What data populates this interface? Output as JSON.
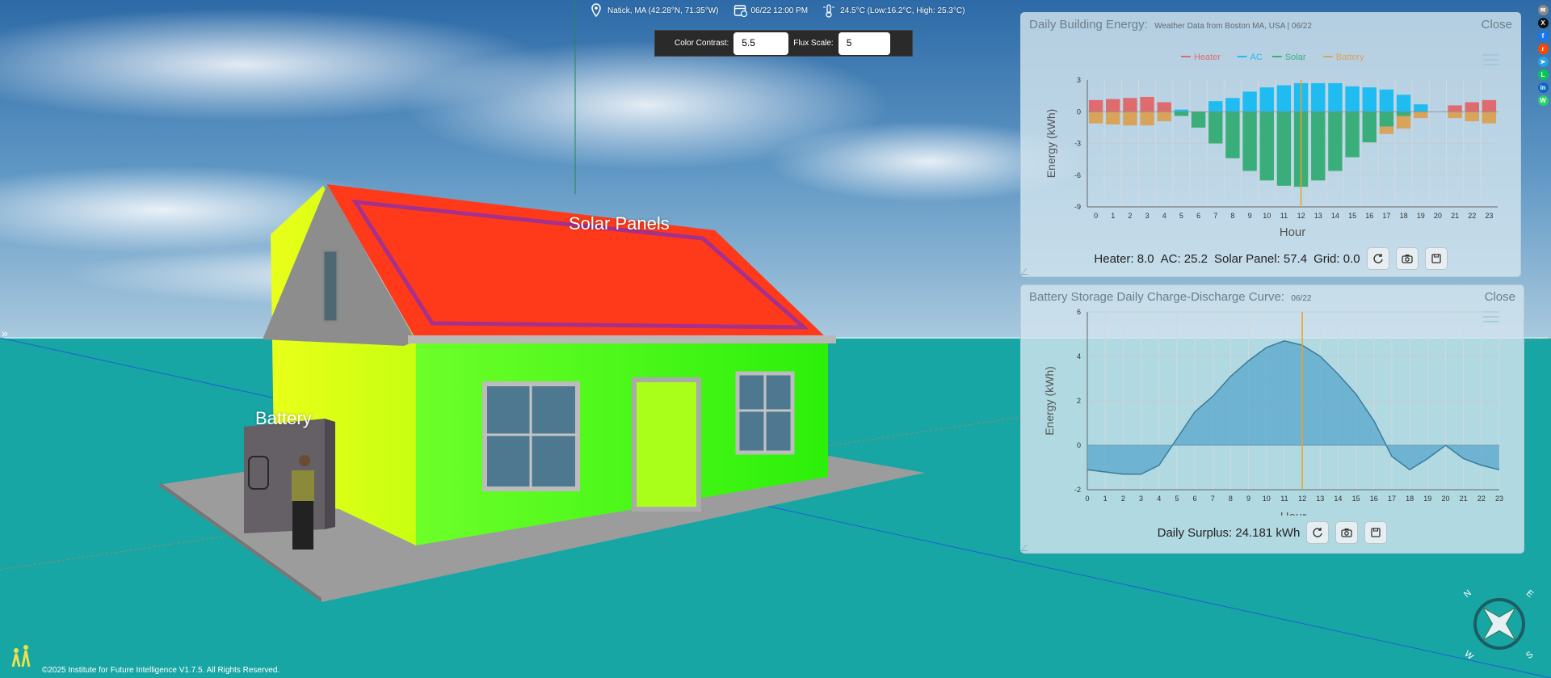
{
  "topbar": {
    "location": "Natick, MA (42.28°N, 71.35°W)",
    "datetime": "06/22 12:00 PM",
    "weather": "24.5°C (Low:16.2°C, High: 25.3°C)"
  },
  "toolbar": {
    "color_contrast_label": "Color Contrast:",
    "color_contrast_value": "5.5",
    "flux_scale_label": "Flux Scale:",
    "flux_scale_value": "5"
  },
  "scene": {
    "solar_label": "Solar Panels",
    "battery_label": "Battery"
  },
  "energy_panel": {
    "title": "Daily Building Energy:",
    "subtitle": "Weather Data from Boston MA, USA | 06/22",
    "close": "Close",
    "footer": {
      "heater": "Heater: 8.0",
      "ac": "AC: 25.2",
      "solar": "Solar Panel: 57.4",
      "grid": "Grid: 0.0"
    }
  },
  "battery_panel": {
    "title": "Battery Storage Daily Charge-Discharge Curve:",
    "subtitle": "06/22",
    "close": "Close",
    "footer": {
      "surplus": "Daily Surplus: 24.181 kWh"
    }
  },
  "copyright": "©2025 Institute for Future Intelligence V1.7.5. All Rights Reserved.",
  "compass": {
    "n": "N",
    "e": "E",
    "s": "S",
    "w": "W"
  },
  "colors": {
    "heater": "#e06b6e",
    "ac": "#1ebcf0",
    "solar": "#3aae7a",
    "battery": "#d8a35a",
    "curve": "#5aa6cc",
    "marker": "#f0a020"
  },
  "chart_data": [
    {
      "type": "bar",
      "legend_position": "top",
      "xlabel": "Hour",
      "ylabel": "Energy (kWh)",
      "ylim": [
        -9,
        3
      ],
      "yticks": [
        3,
        0,
        -3,
        -6,
        -9
      ],
      "categories": [
        "0",
        "1",
        "2",
        "3",
        "4",
        "5",
        "6",
        "7",
        "8",
        "9",
        "10",
        "11",
        "12",
        "13",
        "14",
        "15",
        "16",
        "17",
        "18",
        "19",
        "20",
        "21",
        "22",
        "23"
      ],
      "series": [
        {
          "name": "Heater",
          "values": [
            1.1,
            1.2,
            1.3,
            1.4,
            0.9,
            0,
            0,
            0,
            0,
            0,
            0,
            0,
            0,
            0,
            0,
            0,
            0,
            0,
            0,
            0,
            0,
            0.6,
            0.9,
            1.1
          ]
        },
        {
          "name": "AC",
          "values": [
            0,
            0,
            0,
            0,
            0,
            0.2,
            0,
            1.0,
            1.3,
            1.9,
            2.3,
            2.5,
            2.7,
            2.7,
            2.7,
            2.4,
            2.3,
            2.1,
            1.6,
            0.7,
            0,
            0,
            0,
            0
          ]
        },
        {
          "name": "Solar",
          "values": [
            0,
            0,
            0,
            0,
            0,
            -0.4,
            -1.5,
            -3.0,
            -4.4,
            -5.6,
            -6.5,
            -7.0,
            -7.1,
            -6.5,
            -5.6,
            -4.3,
            -2.9,
            -1.4,
            -0.4,
            0,
            0,
            0,
            0,
            0
          ]
        },
        {
          "name": "Battery",
          "values": [
            -1.1,
            -1.2,
            -1.3,
            -1.3,
            -0.9,
            0,
            0,
            0,
            0,
            0,
            0,
            0,
            0,
            0,
            0,
            0,
            0,
            -0.7,
            -1.2,
            -0.6,
            0,
            -0.6,
            -0.9,
            -1.1
          ]
        }
      ],
      "marker_hour": 12
    },
    {
      "type": "area",
      "xlabel": "Hour",
      "ylabel": "Energy (kWh)",
      "ylim": [
        -2,
        6
      ],
      "yticks": [
        6,
        4,
        2,
        0,
        -2
      ],
      "x": [
        0,
        1,
        2,
        3,
        4,
        5,
        6,
        7,
        8,
        9,
        10,
        11,
        12,
        13,
        14,
        15,
        16,
        17,
        18,
        19,
        20,
        21,
        22,
        23
      ],
      "values": [
        -1.1,
        -1.2,
        -1.3,
        -1.3,
        -0.9,
        0.3,
        1.5,
        2.2,
        3.1,
        3.8,
        4.4,
        4.7,
        4.5,
        4.0,
        3.2,
        2.3,
        1.1,
        -0.5,
        -1.1,
        -0.6,
        0.0,
        -0.6,
        -0.9,
        -1.1
      ],
      "marker_hour": 12
    }
  ]
}
